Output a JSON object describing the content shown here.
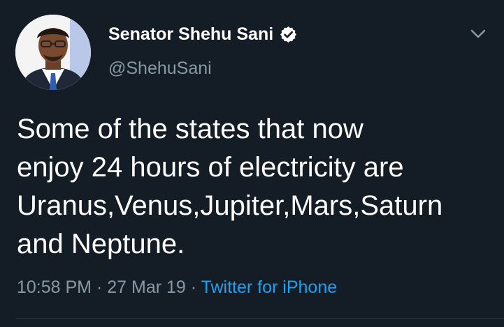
{
  "tweet": {
    "author": {
      "display_name": "Senator Shehu Sani",
      "handle": "@ShehuSani",
      "verified": true,
      "avatar": "avatar-photo"
    },
    "text": "Some of the states that now\nenjoy 24 hours of electricity are\nUranus,Venus,Jupiter,Mars,Saturn\nand Neptune.",
    "time": "10:58 PM",
    "date": "27 Mar 19",
    "separator": "·",
    "source": "Twitter for iPhone"
  },
  "icons": {
    "verified": "verified-badge-icon",
    "menu": "chevron-down-icon"
  },
  "colors": {
    "background": "#141d26",
    "text": "#ffffff",
    "secondary_text": "#8899a6",
    "link": "#1da1f2"
  }
}
